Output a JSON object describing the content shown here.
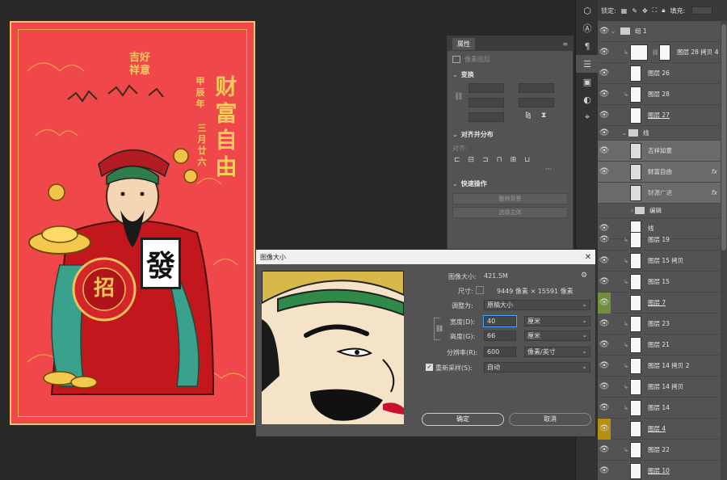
{
  "artwork": {
    "title": "财富自由",
    "blessing": "吉好祥意",
    "year_line": "甲辰年",
    "date_line": "三月廿六",
    "card_char": "發",
    "badge_char": "招"
  },
  "properties_panel": {
    "tab": "属性",
    "layer_type": "像素图层",
    "transform_section": "变换",
    "align_section": "对齐并分布",
    "align_label": "对齐:",
    "quick_actions_section": "快速操作",
    "quick_btn_1": "删除背景",
    "quick_btn_2": "选择主体",
    "more": "···"
  },
  "layers_panel": {
    "lock_label": "锁定:",
    "fill_label": "填充:",
    "items": [
      {
        "name": "组 1"
      },
      {
        "name": "图层 28 拷贝 4"
      },
      {
        "name": "图层 26"
      },
      {
        "name": "图层 28"
      },
      {
        "name": "图层 27"
      },
      {
        "name": "线"
      },
      {
        "name": "吉祥如意"
      },
      {
        "name": "财富自由",
        "fx": "fx"
      },
      {
        "name": "财源广进",
        "fx": "fx"
      },
      {
        "name": "编辑"
      },
      {
        "name": "线"
      },
      {
        "name": "图层 19"
      },
      {
        "name": "图层 15 拷贝"
      },
      {
        "name": "图层 15"
      },
      {
        "name": "图层 7"
      },
      {
        "name": "图层 23"
      },
      {
        "name": "图层 21"
      },
      {
        "name": "图层 14 拷贝 2"
      },
      {
        "name": "图层 14 拷贝"
      },
      {
        "name": "图层 14"
      },
      {
        "name": "图层 4"
      },
      {
        "name": "图层 22"
      },
      {
        "name": "图层 10"
      }
    ]
  },
  "dialog": {
    "title": "图像大小",
    "image_size_label": "图像大小:",
    "image_size_value": "421.5M",
    "dimensions_label": "尺寸:",
    "dimensions_value": "9449 像素 × 15591 像素",
    "fit_label": "调整为:",
    "fit_value": "原稿大小",
    "width_label": "宽度(D):",
    "width_value": "40",
    "width_unit": "厘米",
    "height_label": "高度(G):",
    "height_value": "66",
    "height_unit": "厘米",
    "resolution_label": "分辨率(R):",
    "resolution_value": "600",
    "resolution_unit": "像素/英寸",
    "resample_label": "重新采样(S):",
    "resample_value": "自动",
    "ok_label": "确定",
    "cancel_label": "取消"
  },
  "colors": {
    "canvas_bg": "#282828",
    "artwork_bg": "#f0484a",
    "gold": "#f3c46a",
    "panel_bg": "#535353"
  }
}
